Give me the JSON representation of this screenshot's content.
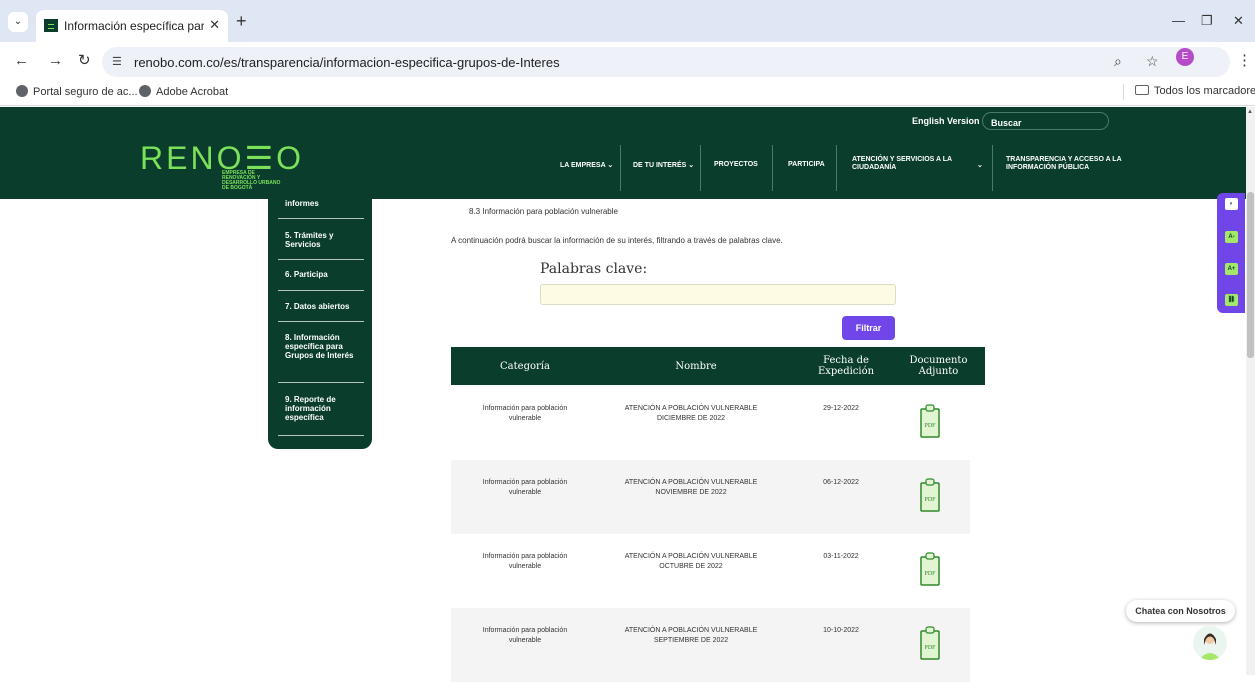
{
  "browser": {
    "tab_title": "Información específica para Gru",
    "tab_close": "✕",
    "new_tab": "+",
    "tab_dropdown": "⌄",
    "window_controls": {
      "minimize": "—",
      "restore": "❐",
      "close": "✕"
    },
    "url": "renobo.com.co/es/transparencia/informacion-especifica-grupos-de-Interes",
    "avatar_letter": "E",
    "bookmarks": [
      "Portal seguro de ac...",
      "Adobe Acrobat"
    ],
    "all_bookmarks": "Todos los marcadores"
  },
  "header": {
    "logo": "RENO☰O",
    "logo_sub": "EMPRESA DE RENOVACIÓN Y DESARROLLO URBANO DE BOGOTÁ",
    "english_version": "English Version",
    "search_placeholder": "Buscar",
    "menu": {
      "empresa": "LA EMPRESA ⌄",
      "interes": "DE TU INTERÉS ⌄",
      "proyectos": "PROYECTOS",
      "participa": "PARTICIPA",
      "atencion_1": "ATENCIÓN Y SERVICIOS A LA",
      "atencion_2": "CIUDADANÍA",
      "atencion_chevron": "⌄",
      "transparencia_1": "TRANSPARENCIA Y ACCESO A LA",
      "transparencia_2": "INFORMACIÓN PÚBLICA"
    }
  },
  "sidebar": {
    "items": [
      "informes",
      "5. Trámites y Servicios",
      "6. Participa",
      "7. Datos abiertos",
      "8. Información específica para Grupos de Interés",
      "9. Reporte de información específica"
    ]
  },
  "main": {
    "sub_item": "8.3 Información para población vulnerable",
    "intro": "A continuación podrá buscar la información de su interés, filtrando a través de palabras clave.",
    "keywords_label": "Palabras clave:",
    "keywords_value": "",
    "filter_button": "Filtrar",
    "table": {
      "headers": {
        "categoria": "Categoría",
        "nombre": "Nombre",
        "fecha_1": "Fecha de",
        "fecha_2": "Expedición",
        "doc_1": "Documento",
        "doc_2": "Adjunto"
      },
      "rows": [
        {
          "cat_1": "Información para población",
          "cat_2": "vulnerable",
          "name_1": "ATENCIÓN A POBLACIÓN VULNERABLE",
          "name_2": "DICIEMBRE DE 2022",
          "date": "29-12-2022",
          "doc": "PDF"
        },
        {
          "cat_1": "Información para población",
          "cat_2": "vulnerable",
          "name_1": "ATENCIÓN A POBLACIÓN VULNERABLE",
          "name_2": "NOVIEMBRE DE 2022",
          "date": "06-12-2022",
          "doc": "PDF"
        },
        {
          "cat_1": "Información para población",
          "cat_2": "vulnerable",
          "name_1": "ATENCIÓN A POBLACIÓN VULNERABLE",
          "name_2": "OCTUBRE DE 2022",
          "date": "03-11-2022",
          "doc": "PDF"
        },
        {
          "cat_1": "Información para población",
          "cat_2": "vulnerable",
          "name_1": "ATENCIÓN A POBLACIÓN VULNERABLE",
          "name_2": "SEPTIEMBRE DE 2022",
          "date": "10-10-2022",
          "doc": "PDF"
        }
      ]
    }
  },
  "accessibility": [
    "contrast-icon",
    "decrease-font-icon",
    "increase-font-icon",
    "link-highlight-icon"
  ],
  "chat": {
    "label": "Chatea con Nosotros"
  },
  "colors": {
    "brand": "#0b3d2c",
    "accent": "#7be05a",
    "button": "#7146e8",
    "input_bg": "#fdfbe4"
  }
}
